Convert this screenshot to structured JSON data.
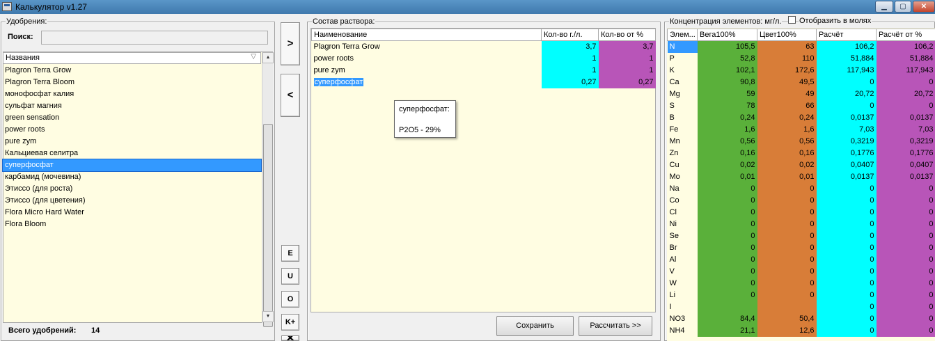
{
  "window": {
    "title": "Калькулятор v1.27"
  },
  "left": {
    "group_label": "Удобрения:",
    "search_label": "Поиск:",
    "search_value": "",
    "list_header": "Названия",
    "items": [
      "Plagron Terra Grow",
      "Plagron Terra Bloom",
      "монофосфат калия",
      "сульфат магния",
      "green sensation",
      "power roots",
      "pure zym",
      "Кальциевая селитра",
      "суперфосфат",
      "карбамид (мочевина)",
      "Этиссо (для роста)",
      "Этиссо (для цветения)",
      "Flora Micro Hard Water",
      "Flora Bloom"
    ],
    "selected_index": 8,
    "total_label": "Всего удобрений:",
    "total_value": "14"
  },
  "nav": {
    "add": ">",
    "remove": "<",
    "e": "E",
    "u": "U",
    "o": "O",
    "k": "K+",
    "x": "✕"
  },
  "middle": {
    "group_label": "Состав раствора:",
    "headers": [
      "Наименование",
      "Кол-во г./л.",
      "Кол-во от %"
    ],
    "rows": [
      {
        "name": "Plagron Terra Grow",
        "qty": "3,7",
        "pct": "3,7"
      },
      {
        "name": "power roots",
        "qty": "1",
        "pct": "1"
      },
      {
        "name": "pure zym",
        "qty": "1",
        "pct": "1"
      },
      {
        "name": "суперфосфат",
        "qty": "0,27",
        "pct": "0,27"
      }
    ],
    "tooltip": {
      "title": "суперфосфат:",
      "line": "P2O5 - 29%"
    },
    "save_label": "Сохранить",
    "calc_label": "Рассчитать >>"
  },
  "right": {
    "group_label": "Концентрация элементов: мг/л.",
    "moles_label": "Отобразить в молях",
    "headers": [
      "Элем...",
      "Вега100%",
      "Цвет100%",
      "Расчёт",
      "Расчёт от %"
    ],
    "rows": [
      [
        "N",
        "105,5",
        "63",
        "106,2",
        "106,2"
      ],
      [
        "P",
        "52,8",
        "110",
        "51,884",
        "51,884"
      ],
      [
        "K",
        "102,1",
        "172,6",
        "117,943",
        "117,943"
      ],
      [
        "Ca",
        "90,8",
        "49,5",
        "0",
        "0"
      ],
      [
        "Mg",
        "59",
        "49",
        "20,72",
        "20,72"
      ],
      [
        "S",
        "78",
        "66",
        "0",
        "0"
      ],
      [
        "B",
        "0,24",
        "0,24",
        "0,0137",
        "0,0137"
      ],
      [
        "Fe",
        "1,6",
        "1,6",
        "7,03",
        "7,03"
      ],
      [
        "Mn",
        "0,56",
        "0,56",
        "0,3219",
        "0,3219"
      ],
      [
        "Zn",
        "0,16",
        "0,16",
        "0,1776",
        "0,1776"
      ],
      [
        "Cu",
        "0,02",
        "0,02",
        "0,0407",
        "0,0407"
      ],
      [
        "Mo",
        "0,01",
        "0,01",
        "0,0137",
        "0,0137"
      ],
      [
        "Na",
        "0",
        "0",
        "0",
        "0"
      ],
      [
        "Co",
        "0",
        "0",
        "0",
        "0"
      ],
      [
        "Cl",
        "0",
        "0",
        "0",
        "0"
      ],
      [
        "Ni",
        "0",
        "0",
        "0",
        "0"
      ],
      [
        "Se",
        "0",
        "0",
        "0",
        "0"
      ],
      [
        "Br",
        "0",
        "0",
        "0",
        "0"
      ],
      [
        "Al",
        "0",
        "0",
        "0",
        "0"
      ],
      [
        "V",
        "0",
        "0",
        "0",
        "0"
      ],
      [
        "W",
        "0",
        "0",
        "0",
        "0"
      ],
      [
        "Li",
        "0",
        "0",
        "0",
        "0"
      ],
      [
        "I",
        "",
        "",
        "0",
        "0"
      ],
      [
        "NO3",
        "84,4",
        "50,4",
        "0",
        "0"
      ],
      [
        "NH4",
        "21,1",
        "12,6",
        "0",
        "0"
      ]
    ]
  },
  "colors": {
    "cyan": "#00ffff",
    "purple": "#b855b8",
    "green": "#5ab03a",
    "orange": "#d87d38",
    "cream": "#fffde2",
    "selection": "#3399ff"
  }
}
